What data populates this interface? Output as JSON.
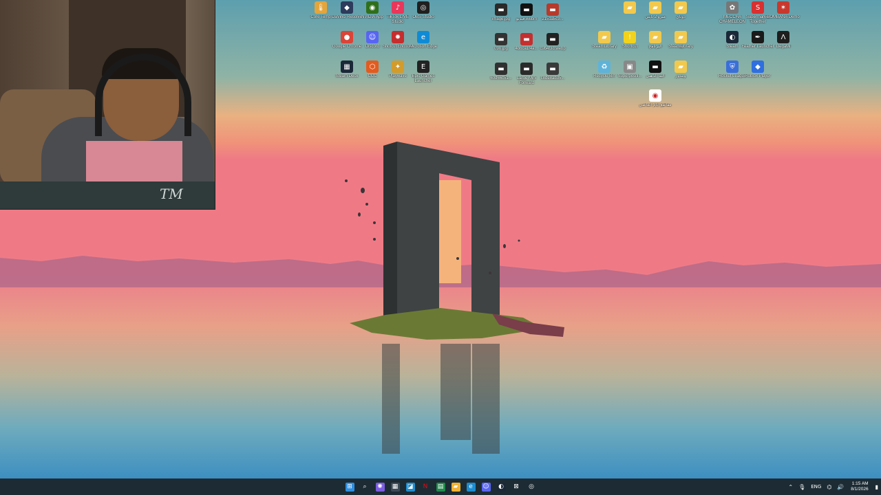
{
  "colors": {
    "taskbar": "#1d2c34",
    "sky_top": "#5d9fae",
    "sky_mid": "#e9a77d",
    "horizon": "#ef7a86",
    "water": "#4e9bc2"
  },
  "desktop_icons": [
    {
      "id": "core-temp",
      "label": "Core Temp",
      "icon": "thermometer-icon",
      "color": "#e4a53b",
      "glyph": "🌡"
    },
    {
      "id": "davinci",
      "label": "DaVinci Resolve",
      "icon": "davinci-icon",
      "color": "#2d3b5c",
      "glyph": "◆"
    },
    {
      "id": "nvidia",
      "label": "NVIDIA App",
      "icon": "nvidia-icon",
      "color": "#2f6f1a",
      "glyph": "◉"
    },
    {
      "id": "tiktok",
      "label": "TikTok LIVE Studio",
      "icon": "tiktok-icon",
      "color": "#e8375a",
      "glyph": "♪"
    },
    {
      "id": "obs",
      "label": "OBS Studio",
      "icon": "obs-icon",
      "color": "#202020",
      "glyph": "◎"
    },
    {
      "id": "chrome",
      "label": "Google Chrome",
      "icon": "chrome-icon",
      "color": "#db4437",
      "glyph": "●"
    },
    {
      "id": "discord",
      "label": "Discord",
      "icon": "discord-icon",
      "color": "#5865f2",
      "glyph": "☺"
    },
    {
      "id": "shotcut",
      "label": "Shotcut Encoder",
      "icon": "shotcut-icon",
      "color": "#c62d2d",
      "glyph": "✹"
    },
    {
      "id": "edge",
      "label": "Microsoft Edge",
      "icon": "edge-icon",
      "color": "#0f8bd6",
      "glyph": "e"
    },
    {
      "id": "epic",
      "label": "Epic Games Launcher",
      "icon": "epic-games-icon",
      "color": "#222",
      "glyph": "E"
    },
    {
      "id": "steamdeck",
      "label": "Steam Deck",
      "icon": "keyboard-icon",
      "color": "#1b2838",
      "glyph": "▦"
    },
    {
      "id": "ccc",
      "label": "CCC",
      "icon": "ccc-icon",
      "color": "#e35b1e",
      "glyph": "⬡"
    },
    {
      "id": "playwave",
      "label": "Playwave",
      "icon": "playwave-icon",
      "color": "#d29b2c",
      "glyph": "✦"
    },
    {
      "id": "image-jpg",
      "label": "image.jpg",
      "icon": "image-file-icon",
      "color": "#2a2a2a",
      "glyph": "▬"
    },
    {
      "id": "webm",
      "label": "فيديو.webm",
      "icon": "video-file-icon",
      "color": "#111",
      "glyph": "▬"
    },
    {
      "id": "photo-2151",
      "label": "2151a5c9...",
      "icon": "image-file-icon",
      "color": "#b73a2a",
      "glyph": "▬"
    },
    {
      "id": "img-2",
      "label": "090.jpg",
      "icon": "image-file-icon",
      "color": "#333",
      "glyph": "▬"
    },
    {
      "id": "img-3",
      "label": "4b6ca1f4a...",
      "icon": "image-file-icon",
      "color": "#c42f2f",
      "glyph": "▬"
    },
    {
      "id": "img-4",
      "label": "c9b4f3d.webp",
      "icon": "image-file-icon",
      "color": "#222",
      "glyph": "▬"
    },
    {
      "id": "img-5",
      "label": "60d66c51...",
      "icon": "image-file-icon",
      "color": "#303030",
      "glyph": "▬"
    },
    {
      "id": "img-6",
      "label": "Large Mini Forward",
      "icon": "image-file-icon",
      "color": "#2b2b2b",
      "glyph": "▬"
    },
    {
      "id": "img-7",
      "label": "c8de8ab35...",
      "icon": "image-file-icon",
      "color": "#3a3a3a",
      "glyph": "▬"
    },
    {
      "id": "folder-1",
      "label": "",
      "icon": "folder-icon",
      "color": "#f2c94c",
      "glyph": "▰"
    },
    {
      "id": "folder-2",
      "label": "ميزو 2 نايتي",
      "icon": "folder-icon",
      "color": "#f2c94c",
      "glyph": "▰"
    },
    {
      "id": "folder-3",
      "label": "دوناي",
      "icon": "folder-icon",
      "color": "#f2c94c",
      "glyph": "▰"
    },
    {
      "id": "folder-4",
      "label": "dij",
      "icon": "folder-icon",
      "color": "#f2c94c",
      "glyph": "▰"
    },
    {
      "id": "steam-library",
      "label": "SteamLibrary",
      "icon": "folder-icon",
      "color": "#f2c94c",
      "glyph": "▰"
    },
    {
      "id": "shortcut",
      "label": "Shortcut",
      "icon": "shield-icon",
      "color": "#f2d21b",
      "glyph": "!"
    },
    {
      "id": "folder-5",
      "label": "البرنامج",
      "icon": "folder-icon",
      "color": "#f2c94c",
      "glyph": "▰"
    },
    {
      "id": "steam-library-2",
      "label": "SteamLibrary",
      "icon": "folder-icon",
      "color": "#f2c94c",
      "glyph": "▰"
    },
    {
      "id": "recycle-bin",
      "label": "Recycle Bin",
      "icon": "recycle-bin-icon",
      "color": "#5fb3d9",
      "glyph": "♻"
    },
    {
      "id": "superposition",
      "label": "Superpositi...",
      "icon": "superposition-icon",
      "color": "#888",
      "glyph": "▣"
    },
    {
      "id": "doc-1",
      "label": "البنا الذهبي",
      "icon": "video-file-icon",
      "color": "#111",
      "glyph": "▬"
    },
    {
      "id": "folder-6",
      "label": "ويندوز",
      "icon": "folder-icon",
      "color": "#f2c94c",
      "glyph": "▰"
    },
    {
      "id": "pdf-1",
      "label": "مقاطع ايام الماضي",
      "icon": "document-icon",
      "color": "#ffffff",
      "glyph": "◉"
    },
    {
      "id": "meccha",
      "label": "MECCHA CHAMELEON",
      "icon": "meccha-icon",
      "color": "#777",
      "glyph": "✿"
    },
    {
      "id": "supermarket",
      "label": "Supermarket Together",
      "icon": "supermarket-icon",
      "color": "#d93030",
      "glyph": "S"
    },
    {
      "id": "bombanana",
      "label": "BOMBANA Demo",
      "icon": "bombanana-icon",
      "color": "#c8382d",
      "glyph": "✶"
    },
    {
      "id": "steam",
      "label": "Steam",
      "icon": "steam-icon",
      "color": "#1b2838",
      "glyph": "◐"
    },
    {
      "id": "feather",
      "label": "Feather Launcher",
      "icon": "feather-icon",
      "color": "#1a1a1a",
      "glyph": "✒"
    },
    {
      "id": "lunar",
      "label": "LlegaMi",
      "icon": "lunar-icon",
      "color": "#1e1e1e",
      "glyph": "Λ"
    },
    {
      "id": "rocket",
      "label": "Rocket League",
      "icon": "rocket-league-icon",
      "color": "#3b6fd8",
      "glyph": "⛨"
    },
    {
      "id": "roblox",
      "label": "Roblox Player",
      "icon": "roblox-icon",
      "color": "#2f6fe0",
      "glyph": "◆"
    }
  ],
  "taskbar": {
    "icons": [
      {
        "id": "start",
        "icon": "windows-start-icon",
        "color": "#2f8fe0",
        "glyph": "⊞"
      },
      {
        "id": "search",
        "icon": "search-icon",
        "color": "transparent",
        "glyph": "⌕"
      },
      {
        "id": "copilot",
        "icon": "copilot-icon",
        "color": "#7b5de0",
        "glyph": "✺"
      },
      {
        "id": "store-app",
        "icon": "store-icon",
        "color": "#3b4a55",
        "glyph": "▦"
      },
      {
        "id": "photos",
        "icon": "photos-icon",
        "color": "#1e8fd0",
        "glyph": "◪"
      },
      {
        "id": "netflix",
        "icon": "netflix-icon",
        "color": "transparent",
        "glyph": "N"
      },
      {
        "id": "excel",
        "icon": "spreadsheet-icon",
        "color": "#1f8b4c",
        "glyph": "▤"
      },
      {
        "id": "explorer",
        "icon": "file-explorer-icon",
        "color": "#f2b233",
        "glyph": "▰"
      },
      {
        "id": "edge",
        "icon": "edge-icon",
        "color": "#1b8cd0",
        "glyph": "e"
      },
      {
        "id": "discord",
        "icon": "discord-icon",
        "color": "#5865f2",
        "glyph": "☺"
      },
      {
        "id": "steam",
        "icon": "steam-icon",
        "color": "#1b2838",
        "glyph": "◐"
      },
      {
        "id": "capture",
        "icon": "capture-icon",
        "color": "transparent",
        "glyph": "⊠"
      },
      {
        "id": "obs",
        "icon": "obs-icon",
        "color": "transparent",
        "glyph": "◎"
      }
    ],
    "tray": {
      "chevron": "⌃",
      "language": "ENG",
      "time": "1:15 AM",
      "date": "8/1/2026"
    }
  }
}
